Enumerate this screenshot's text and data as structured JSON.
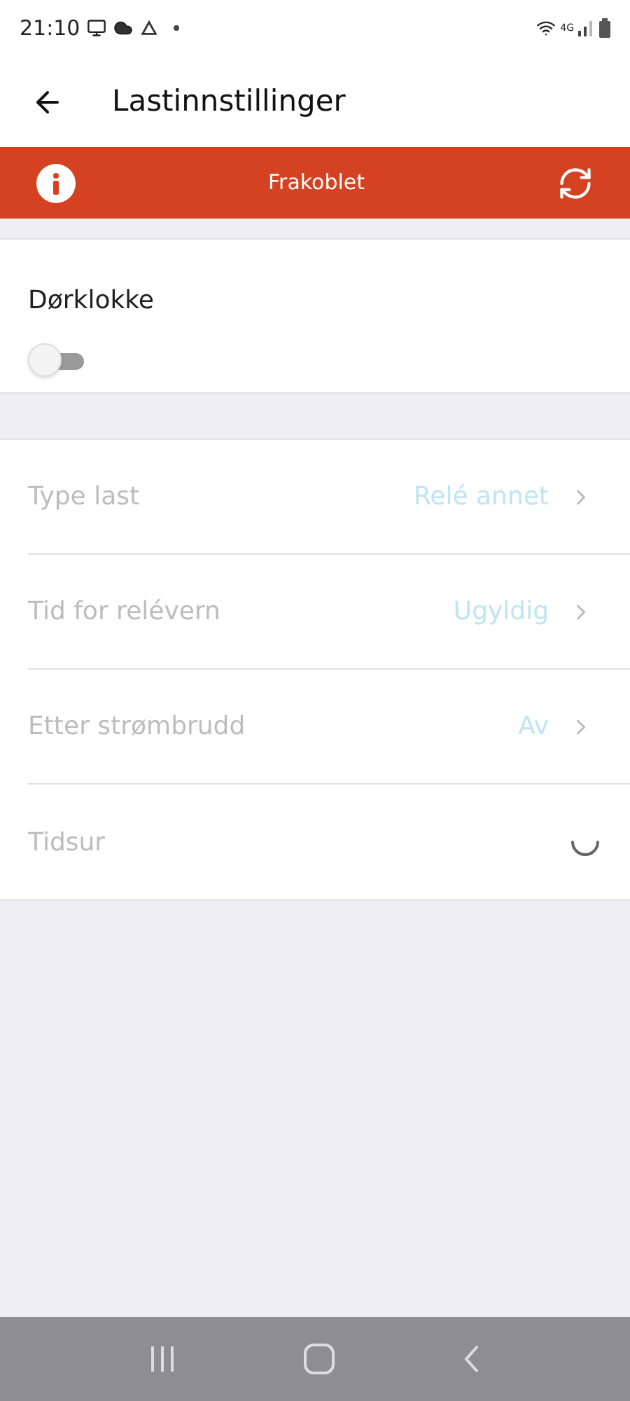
{
  "status_bar": {
    "time": "21:10",
    "network": "4G"
  },
  "header": {
    "title": "Lastinnstillinger"
  },
  "banner": {
    "text": "Frakoblet"
  },
  "doorbell": {
    "label": "Dørklokke",
    "on": false
  },
  "settings": [
    {
      "kind": "link",
      "label": "Type last",
      "value": "Relé annet",
      "disabled": true
    },
    {
      "kind": "link",
      "label": "Tid for relévern",
      "value": "Ugyldig",
      "disabled": true
    },
    {
      "kind": "link",
      "label": "Etter strømbrudd",
      "value": "Av",
      "disabled": true
    },
    {
      "kind": "loading",
      "label": "Tidsur",
      "disabled": true
    }
  ]
}
